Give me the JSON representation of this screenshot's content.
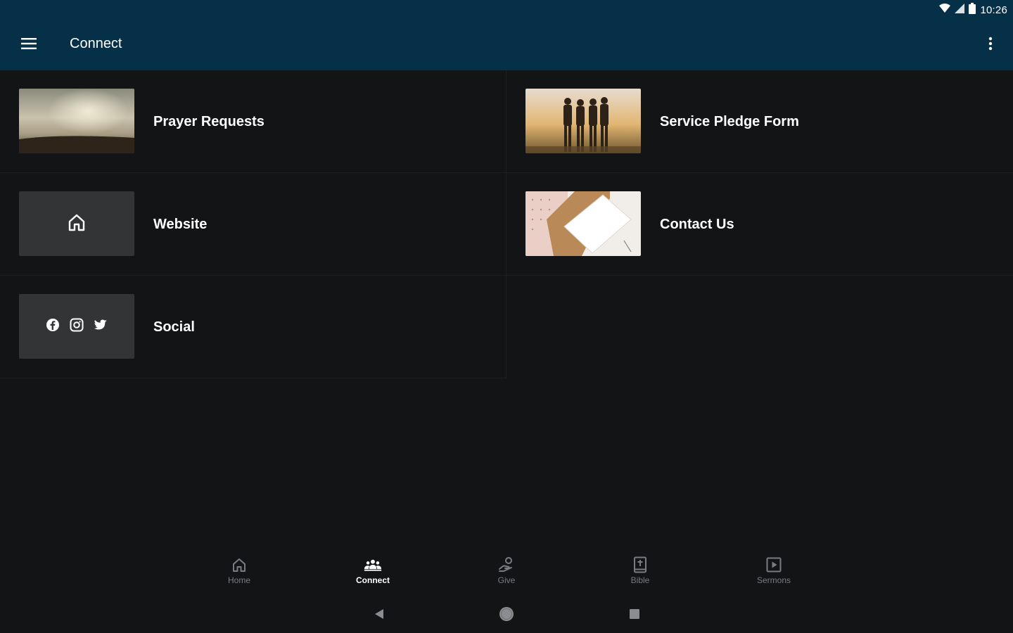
{
  "status_bar": {
    "time": "10:26"
  },
  "app_bar": {
    "title": "Connect"
  },
  "cards": [
    {
      "label": "Prayer Requests",
      "thumb": "sky-photo"
    },
    {
      "label": "Service Pledge Form",
      "thumb": "friends-sunset-photo"
    },
    {
      "label": "Website",
      "thumb": "home-icon"
    },
    {
      "label": "Contact Us",
      "thumb": "notebooks-photo"
    },
    {
      "label": "Social",
      "thumb": "social-icons"
    }
  ],
  "bottom_nav": [
    {
      "label": "Home",
      "icon": "home-icon",
      "active": false
    },
    {
      "label": "Connect",
      "icon": "people-icon",
      "active": true
    },
    {
      "label": "Give",
      "icon": "give-icon",
      "active": false
    },
    {
      "label": "Bible",
      "icon": "bible-icon",
      "active": false
    },
    {
      "label": "Sermons",
      "icon": "play-icon",
      "active": false
    }
  ],
  "colors": {
    "app_bar": "#063048",
    "background": "#131416",
    "tile": "#333436",
    "inactive_nav": "#7a7c80"
  }
}
